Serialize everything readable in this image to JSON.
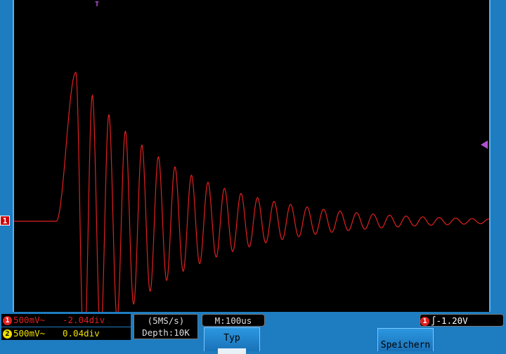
{
  "channels": [
    {
      "id": "1",
      "scale": "500mV~",
      "offset": "-2.04div",
      "color": "#e02020"
    },
    {
      "id": "2",
      "scale": "500mV~",
      "offset": "0.04div",
      "color": "#f0e000"
    }
  ],
  "acquisition": {
    "rate": "(5MS/s)",
    "depth": "Depth:10K"
  },
  "timebase": {
    "label": "M:100us"
  },
  "trigger": {
    "source": "1",
    "level": "-1.20V",
    "marker_label": "T"
  },
  "menu": {
    "type_label": "Typ",
    "save_label": "Speichern"
  },
  "colors": {
    "background": "#1e7cc0",
    "screen": "#000000",
    "trace": "#e02020",
    "trigger_marker": "#b050d0"
  }
}
